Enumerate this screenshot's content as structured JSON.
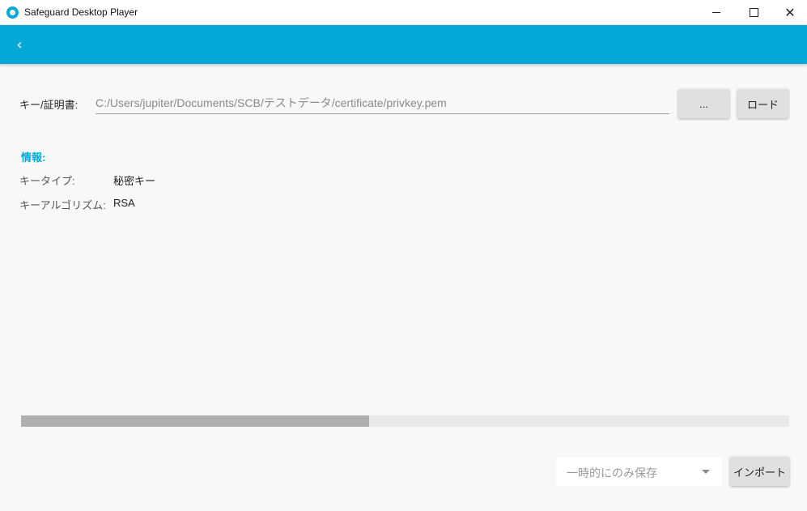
{
  "window": {
    "title": "Safeguard Desktop Player",
    "controls": [
      "minimize-icon",
      "maximize-icon",
      "close-icon"
    ],
    "close_glyph": "✕"
  },
  "appbar": {
    "color": "#06a8d8",
    "back_glyph": "‹"
  },
  "key_section": {
    "label": "キー/証明書:",
    "path_value": "C:/Users/jupiter/Documents/SCB/テストデータ/certificate/privkey.pem",
    "browse_label": "...",
    "load_label": "ロード"
  },
  "info": {
    "heading": "情報:",
    "rows": [
      {
        "key": "キータイプ:",
        "value": "秘密キー"
      },
      {
        "key": "キーアルゴリズム:",
        "value": "RSA"
      }
    ]
  },
  "progress": {
    "fraction": 0.453
  },
  "footer": {
    "storage_selected": "一時的にのみ保存",
    "import_label": "インポート"
  }
}
